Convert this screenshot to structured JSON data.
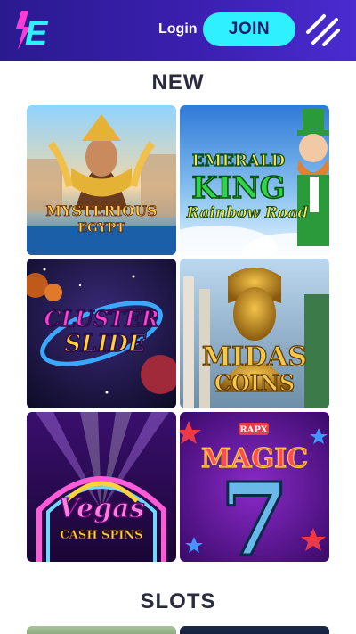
{
  "header": {
    "login_label": "Login",
    "join_label": "JOIN",
    "logo_letter": "E"
  },
  "sections": [
    {
      "title": "NEW",
      "games": [
        {
          "line1": "MYSTERIOUS",
          "line2": "EGYPT"
        },
        {
          "line1": "EMERALD",
          "line2": "KING",
          "line3": "Rainbow Road"
        },
        {
          "line1": "CLUSTER",
          "line2": "SLIDE"
        },
        {
          "line1": "MIDAS",
          "line2": "COINS"
        },
        {
          "line1": "Vegas",
          "line2": "CASH SPINS"
        },
        {
          "badge": "RAPX",
          "line1": "MAGIC",
          "line2": "7"
        }
      ]
    },
    {
      "title": "SLOTS"
    }
  ],
  "colors": {
    "header": "#3b1fb0",
    "join_button": "#2ff0ff",
    "title_text": "#2b2b40"
  }
}
